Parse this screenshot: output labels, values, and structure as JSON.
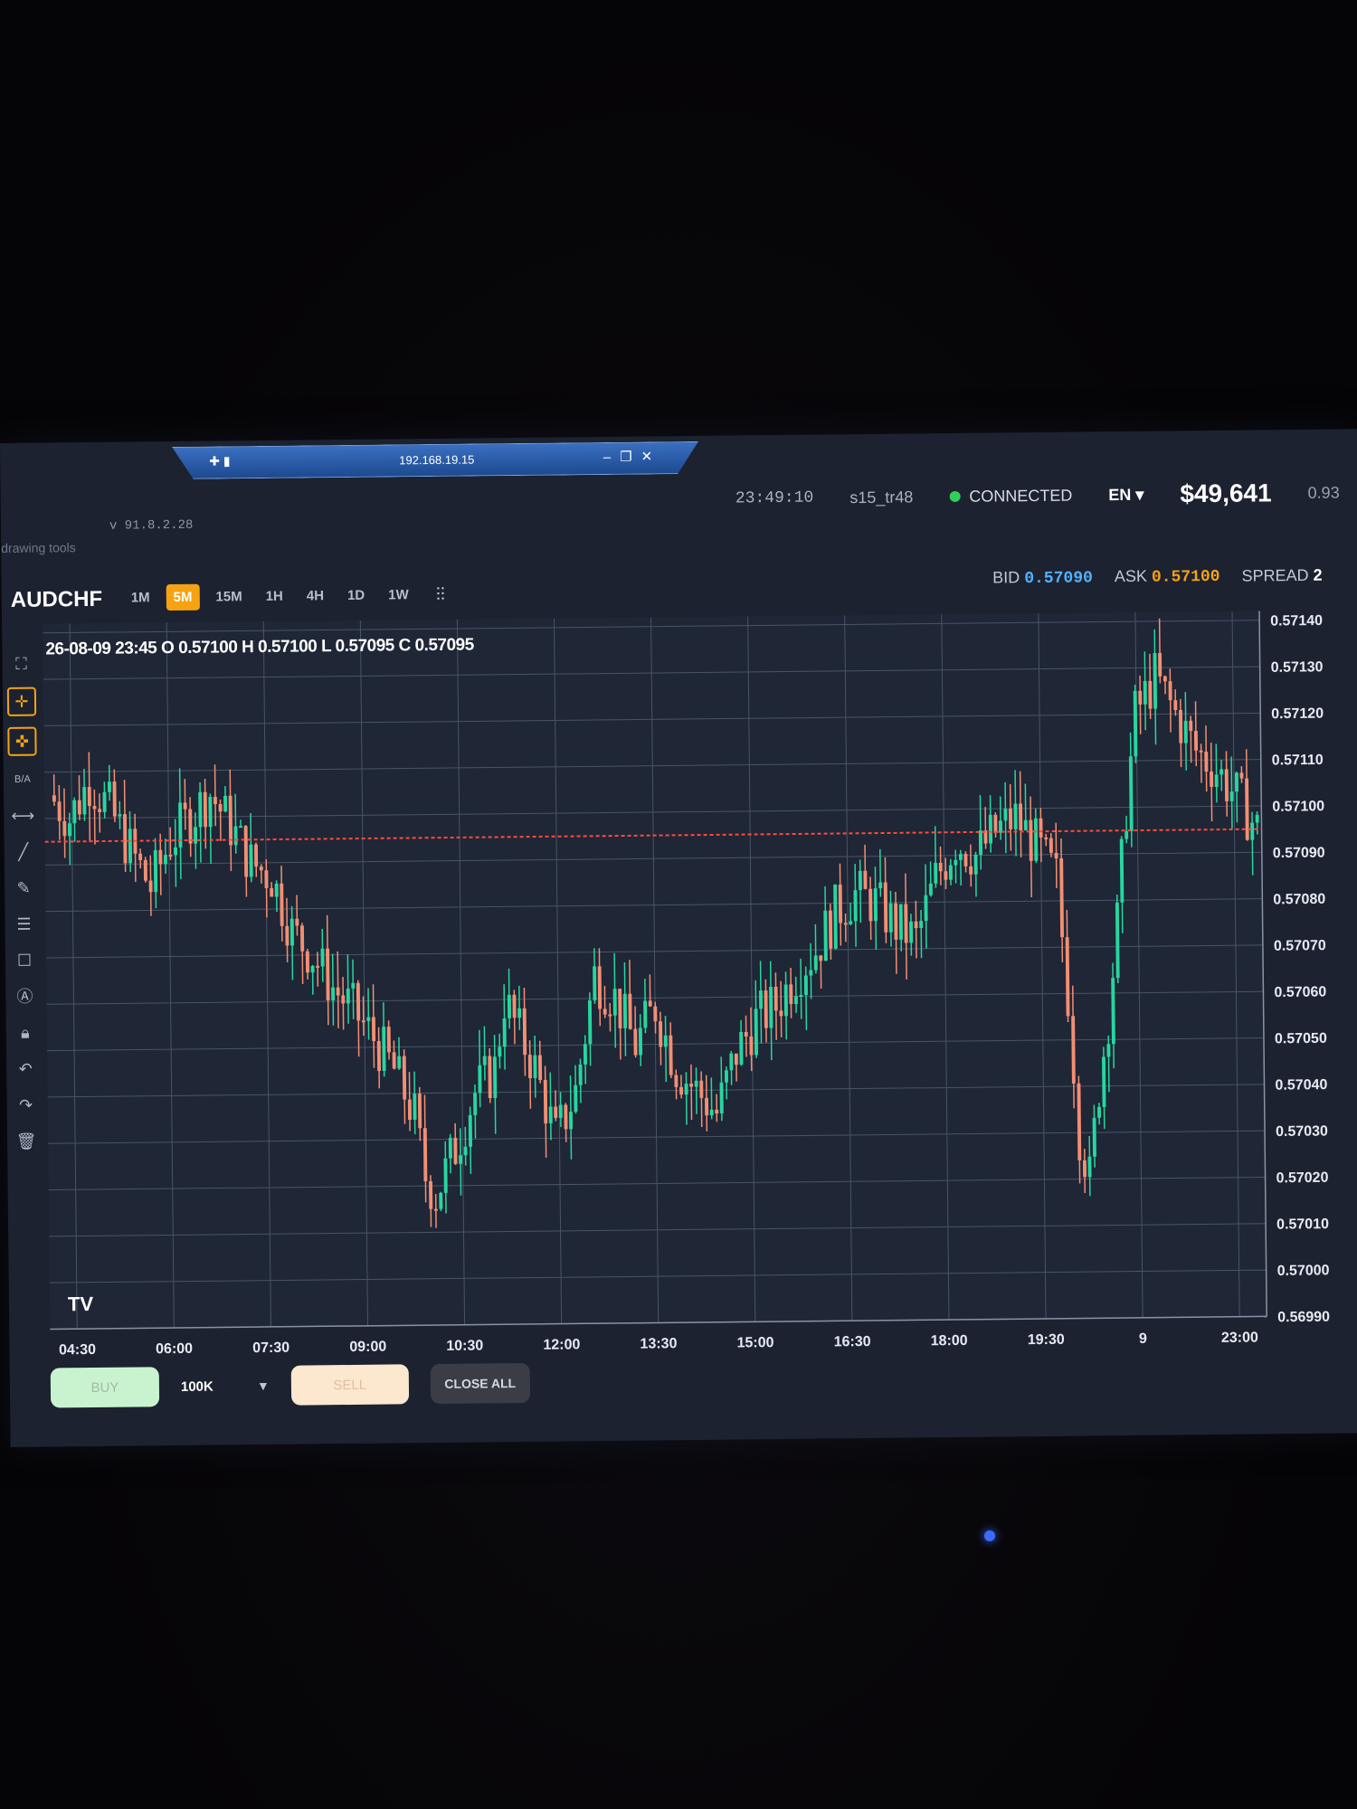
{
  "window": {
    "remote_host": "192.168.19.15",
    "version": "v 91.8.2.28",
    "drawing_tools_label": "drawing tools"
  },
  "status": {
    "time": "23:49:10",
    "user": "s15_tr48",
    "connection": "CONNECTED",
    "language": "EN",
    "balance": "$49,641",
    "small_value": "0.93",
    "connection_color": "#2fcf59"
  },
  "instrument": {
    "symbol": "AUDCHF",
    "timeframes": [
      "1M",
      "5M",
      "15M",
      "1H",
      "4H",
      "1D",
      "1W"
    ],
    "active_timeframe": "5M",
    "bid_label": "BID",
    "bid": "0.57090",
    "ask_label": "ASK",
    "ask": "0.57100",
    "spread_label": "SPREAD",
    "spread": "2"
  },
  "toolbar_icons": [
    "fullscreen-icon",
    "crosshair-icon",
    "magnet-icon",
    "bid-ask-icon",
    "horizontal-line-icon",
    "trend-line-icon",
    "pencil-icon",
    "fibonacci-icon",
    "rectangle-icon",
    "text-annotation-icon",
    "lock-icon",
    "undo-icon",
    "redo-icon",
    "trash-icon"
  ],
  "toolbar_labels": {
    "bid_ask": "B/A"
  },
  "ohlc": {
    "text": "26-08-09 23:45 O 0.57100 H 0.57100 L 0.57095 C 0.57095"
  },
  "chart_data": {
    "type": "candlestick",
    "colors": {
      "up": "#27d6a0",
      "down": "#f28f74",
      "price_line": "#ff4b3e",
      "grid": "#4a5468",
      "background": "#1f2636"
    },
    "y_ticks": [
      "0.57140",
      "0.57130",
      "0.57120",
      "0.57110",
      "0.57100",
      "0.57090",
      "0.57080",
      "0.57070",
      "0.57060",
      "0.57050",
      "0.57040",
      "0.57030",
      "0.57020",
      "0.57010",
      "0.57000",
      "0.56990"
    ],
    "ylim": [
      0.5699,
      0.57142
    ],
    "x_ticks": [
      "04:30",
      "06:00",
      "07:30",
      "09:00",
      "10:30",
      "12:00",
      "13:30",
      "15:00",
      "16:30",
      "18:00",
      "19:30",
      "9",
      "23:00"
    ],
    "current_price": 0.57095,
    "close_path": [
      [
        0,
        0.57105
      ],
      [
        4,
        0.571
      ],
      [
        8,
        0.57108
      ],
      [
        12,
        0.57102
      ],
      [
        16,
        0.57093
      ],
      [
        20,
        0.57085
      ],
      [
        24,
        0.57095
      ],
      [
        28,
        0.571
      ],
      [
        32,
        0.57105
      ],
      [
        36,
        0.57098
      ],
      [
        40,
        0.5709
      ],
      [
        44,
        0.57087
      ],
      [
        48,
        0.57075
      ],
      [
        52,
        0.5707
      ],
      [
        56,
        0.57063
      ],
      [
        60,
        0.57058
      ],
      [
        64,
        0.57052
      ],
      [
        68,
        0.57045
      ],
      [
        72,
        0.57035
      ],
      [
        74,
        0.57022
      ],
      [
        76,
        0.57018
      ],
      [
        80,
        0.57028
      ],
      [
        84,
        0.5704
      ],
      [
        88,
        0.57045
      ],
      [
        90,
        0.5706
      ],
      [
        92,
        0.57055
      ],
      [
        96,
        0.57045
      ],
      [
        100,
        0.5703
      ],
      [
        104,
        0.5704
      ],
      [
        108,
        0.57065
      ],
      [
        112,
        0.5706
      ],
      [
        116,
        0.5705
      ],
      [
        120,
        0.57058
      ],
      [
        124,
        0.57045
      ],
      [
        128,
        0.5704
      ],
      [
        132,
        0.57035
      ],
      [
        136,
        0.57048
      ],
      [
        140,
        0.57055
      ],
      [
        144,
        0.57058
      ],
      [
        148,
        0.57065
      ],
      [
        152,
        0.5707
      ],
      [
        156,
        0.57078
      ],
      [
        160,
        0.57082
      ],
      [
        164,
        0.5708
      ],
      [
        168,
        0.57075
      ],
      [
        172,
        0.57072
      ],
      [
        176,
        0.57085
      ],
      [
        180,
        0.57093
      ],
      [
        184,
        0.5709
      ],
      [
        188,
        0.57095
      ],
      [
        192,
        0.57098
      ],
      [
        196,
        0.57092
      ],
      [
        200,
        0.57085
      ],
      [
        202,
        0.5706
      ],
      [
        204,
        0.5703
      ],
      [
        206,
        0.5702
      ],
      [
        208,
        0.5704
      ],
      [
        210,
        0.57055
      ],
      [
        212,
        0.57075
      ],
      [
        214,
        0.571
      ],
      [
        216,
        0.5712
      ],
      [
        220,
        0.57128
      ],
      [
        224,
        0.5712
      ],
      [
        228,
        0.57112
      ],
      [
        232,
        0.57108
      ],
      [
        236,
        0.57102
      ],
      [
        240,
        0.57095
      ]
    ]
  },
  "orders": {
    "buy": "BUY",
    "lot_size": "100K",
    "sell": "SELL",
    "close_all": "CLOSE ALL"
  }
}
